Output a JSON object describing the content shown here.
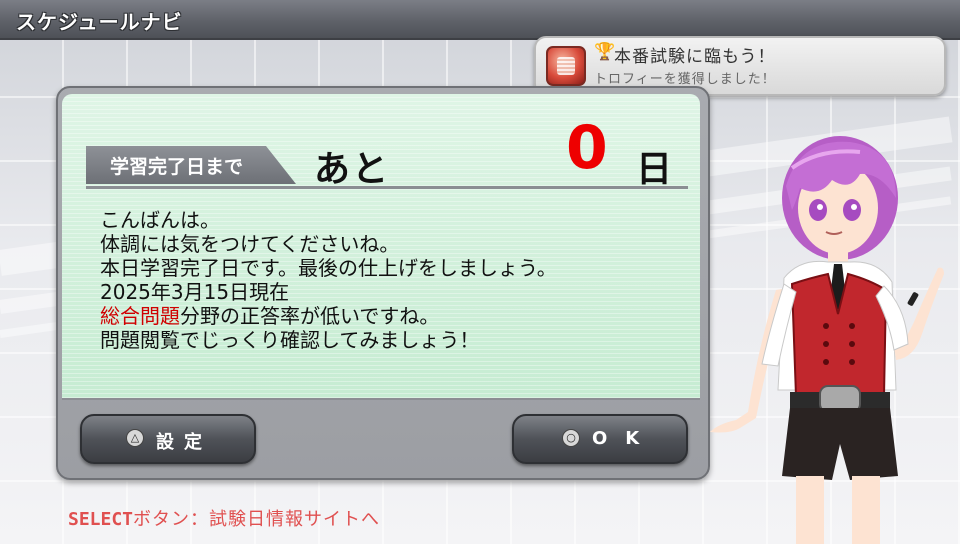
{
  "header": {
    "title": "スケジュールナビ"
  },
  "trophy": {
    "title": "本番試験に臨もう！",
    "subtitle": "トロフィーを獲得しました！",
    "cup_icon": "🏆"
  },
  "countdown": {
    "label": "学習完了日まで",
    "prefix": "あと",
    "days": "0",
    "unit": "日"
  },
  "message": {
    "line1": "こんばんは。",
    "line2": "体調には気をつけてくださいね。",
    "line3": "本日学習完了日です。最後の仕上げをしましょう。",
    "line4": "2025年3月15日現在",
    "line5_highlight": "総合問題",
    "line5_rest": "分野の正答率が低いですね。",
    "line6": "問題閲覧でじっくり確認してみましょう！"
  },
  "buttons": {
    "settings": {
      "icon": "△",
      "label": "設定"
    },
    "ok": {
      "icon": "○",
      "label": "OK"
    }
  },
  "footer": {
    "select_label": "SELECT",
    "hint": "ボタン：試験日情報サイトへ"
  },
  "colors": {
    "accent_red": "#ee0000",
    "screen_green": "#c6ecd2"
  }
}
